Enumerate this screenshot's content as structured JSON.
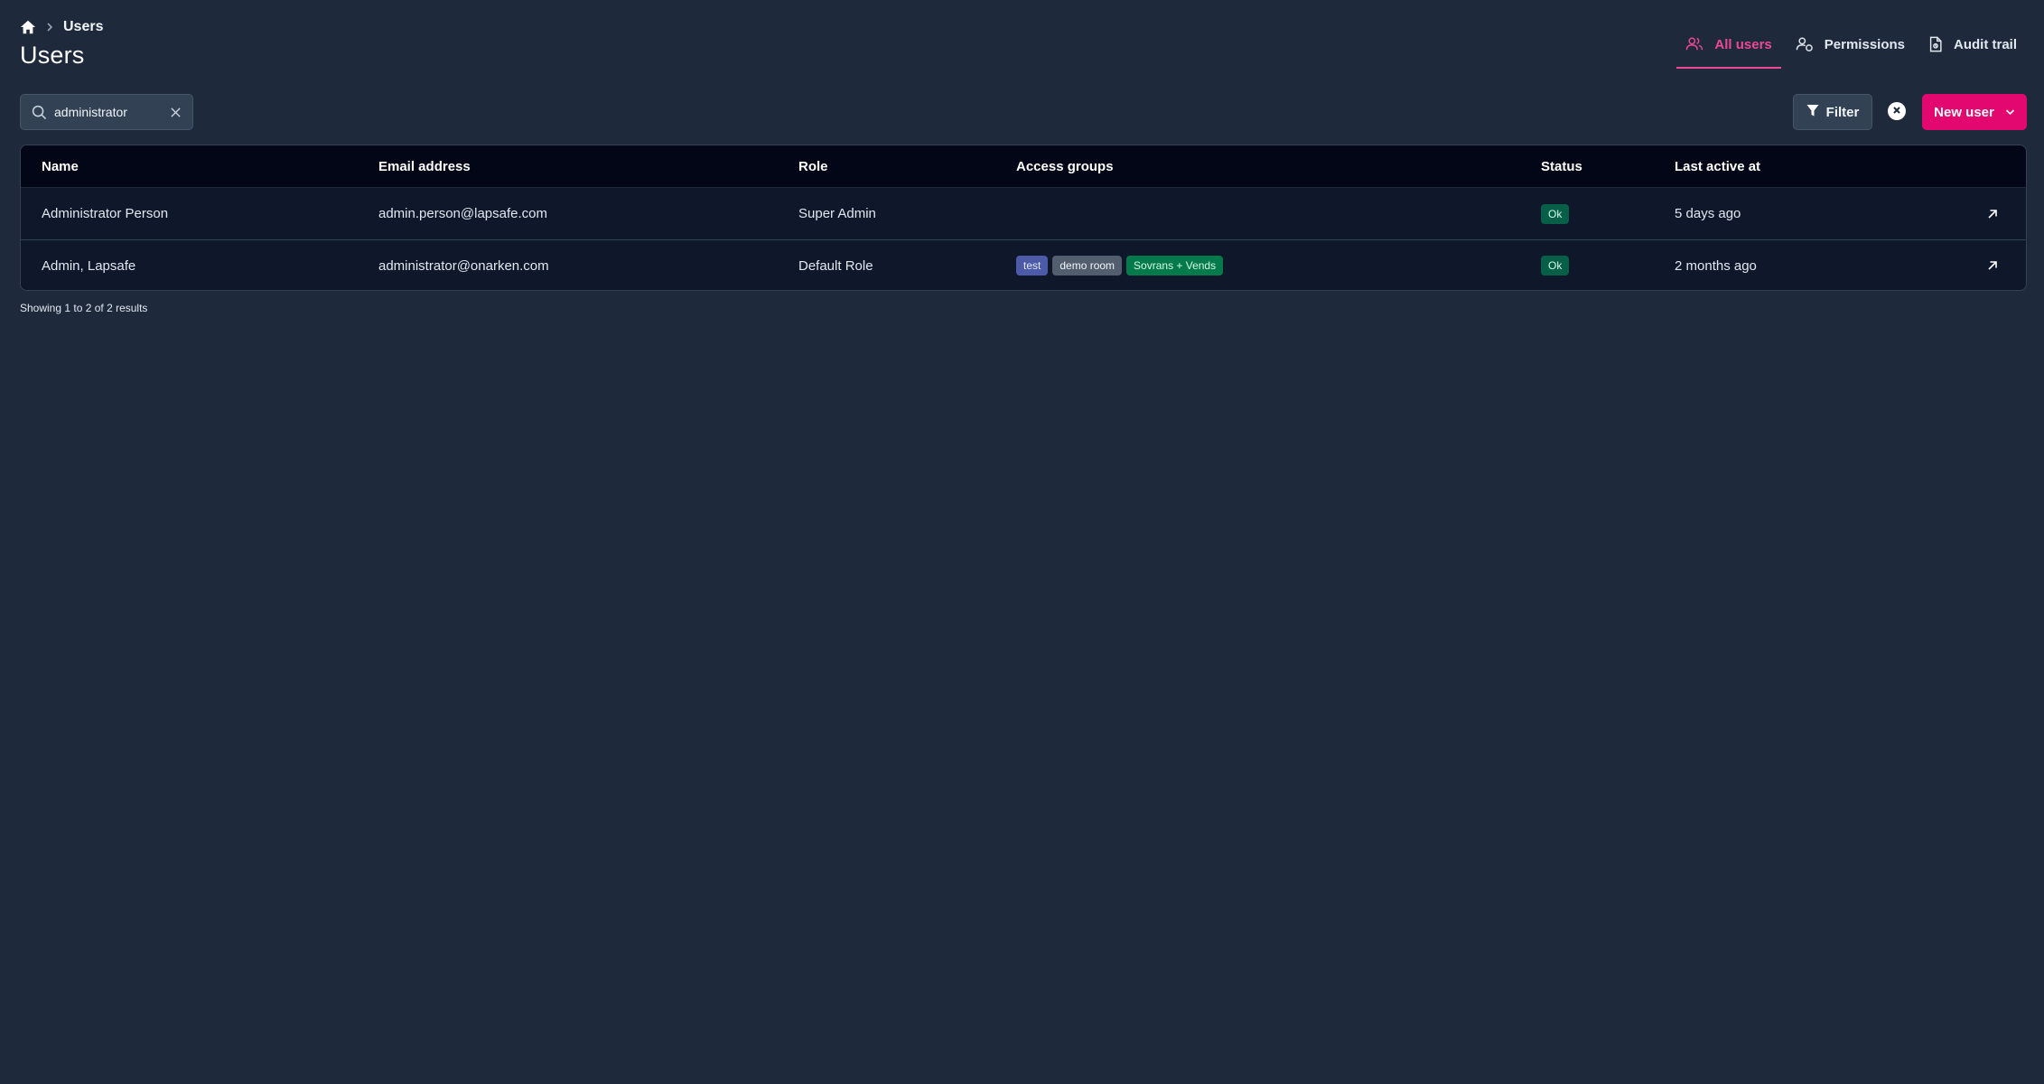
{
  "breadcrumb": {
    "home_icon": "home-icon",
    "current": "Users"
  },
  "page": {
    "title": "Users"
  },
  "tabs": [
    {
      "label": "All users",
      "icon": "users-icon",
      "active": true
    },
    {
      "label": "Permissions",
      "icon": "user-permissions-icon",
      "active": false
    },
    {
      "label": "Audit trail",
      "icon": "document-icon",
      "active": false
    }
  ],
  "search": {
    "value": "administrator",
    "placeholder": "Search"
  },
  "toolbar": {
    "filter_label": "Filter",
    "new_user_label": "New user"
  },
  "table": {
    "columns": {
      "name": "Name",
      "email": "Email address",
      "role": "Role",
      "groups": "Access groups",
      "status": "Status",
      "last_active": "Last active at"
    },
    "rows": [
      {
        "name": "Administrator Person",
        "email": "admin.person@lapsafe.com",
        "role": "Super Admin",
        "groups": [],
        "status": "Ok",
        "last_active": "5 days ago"
      },
      {
        "name": "Admin, Lapsafe",
        "email": "administrator@onarken.com",
        "role": "Default Role",
        "groups": [
          "test",
          "demo room",
          "Sovrans + Vends"
        ],
        "status": "Ok",
        "last_active": "2 months ago"
      }
    ]
  },
  "summary": "Showing 1 to 2 of 2 results",
  "colors": {
    "background": "#1e293b",
    "accent": "#ec4899",
    "primary_button": "#e2086f",
    "status_ok": "#065f46"
  }
}
